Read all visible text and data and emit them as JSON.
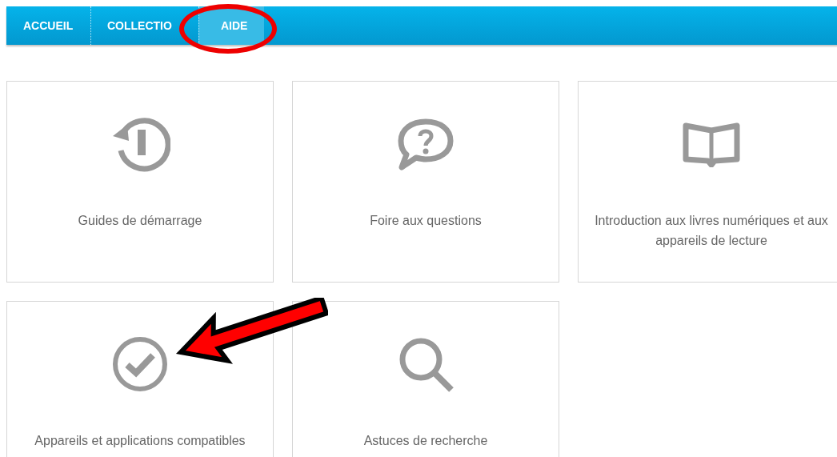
{
  "nav": {
    "tabs": [
      {
        "label": "ACCUEIL",
        "selected": false
      },
      {
        "label": "COLLECTIO",
        "selected": false
      },
      {
        "label": "AIDE",
        "selected": true
      }
    ]
  },
  "cards": [
    {
      "label": "Guides de démarrage"
    },
    {
      "label": "Foire aux questions"
    },
    {
      "label": "Introduction aux livres numériques et aux appareils de lecture"
    },
    {
      "label": "Appareils et applications compatibles"
    },
    {
      "label": "Astuces de recherche"
    }
  ]
}
